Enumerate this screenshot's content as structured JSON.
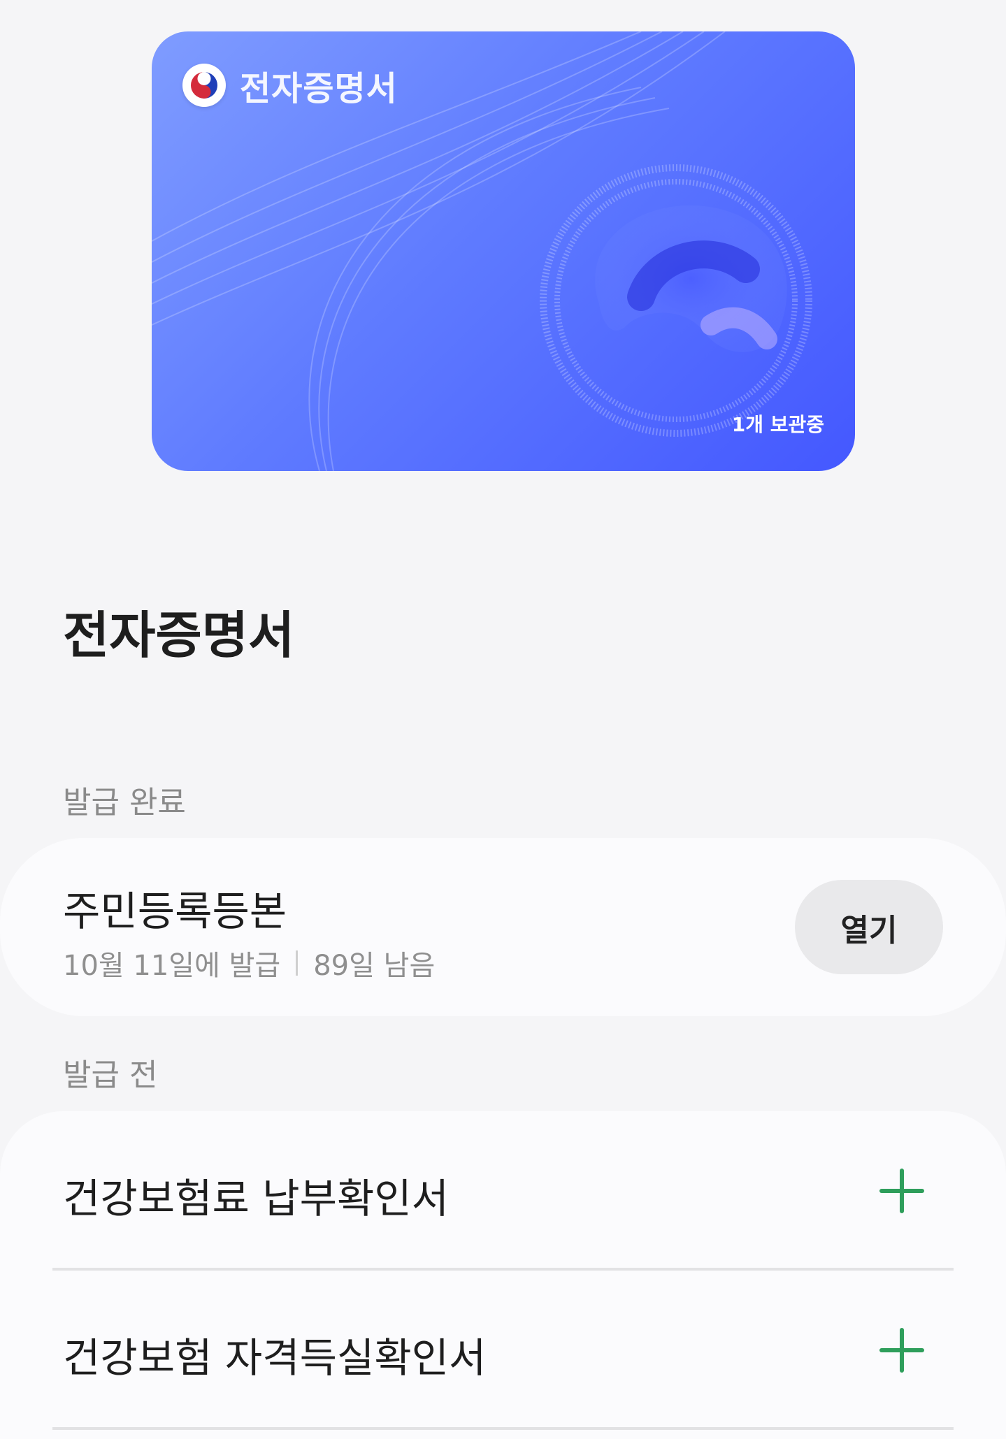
{
  "card": {
    "title": "전자증명서",
    "count": "1개 보관중",
    "colors": {
      "start": "#7f9cff",
      "end": "#4458ff"
    },
    "emblem_icon": "taegeuk-emblem-icon"
  },
  "page_title": "전자증명서",
  "sections": {
    "issued": {
      "label": "발급 완료",
      "items": [
        {
          "name": "주민등록등본",
          "issued_date": "10월 11일에 발급",
          "remaining": "89일 남음",
          "action_label": "열기"
        }
      ]
    },
    "pending": {
      "label": "발급 전",
      "items": [
        {
          "name": "건강보험료 납부확인서",
          "action_icon": "plus-icon"
        },
        {
          "name": "건강보험 자격득실확인서",
          "action_icon": "plus-icon"
        }
      ],
      "accent": "#2e9e5b"
    }
  }
}
